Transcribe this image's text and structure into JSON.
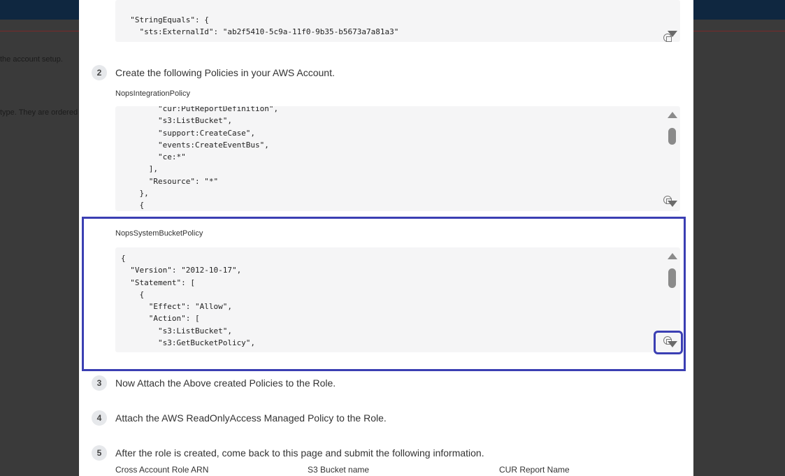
{
  "background": {
    "text_1": "the account setup.",
    "text_2": "type. They are ordered"
  },
  "top_code": {
    "lines": [
      "  \"StringEquals\": {",
      "    \"sts:ExternalId\": \"ab2f5410-5c9a-11f0-9b35-b5673a7a81a3\""
    ]
  },
  "steps": [
    {
      "number": "2",
      "text": "Create the following Policies in your AWS Account."
    },
    {
      "number": "3",
      "text": "Now Attach the Above created Policies to the Role."
    },
    {
      "number": "4",
      "text": "Attach the AWS ReadOnlyAccess Managed Policy to the Role."
    },
    {
      "number": "5",
      "text": "After the role is created, come back to this page and submit the following information."
    }
  ],
  "policies": [
    {
      "name": "NopsIntegrationPolicy",
      "code": "        \"cur:PutReportDefinition\",\n        \"s3:ListBucket\",\n        \"support:CreateCase\",\n        \"events:CreateEventBus\",\n        \"ce:*\"\n      ],\n      \"Resource\": \"*\"\n    },\n    {"
    },
    {
      "name": "NopsSystemBucketPolicy",
      "code": "{\n  \"Version\": \"2012-10-17\",\n  \"Statement\": [\n    {\n      \"Effect\": \"Allow\",\n      \"Action\": [\n        \"s3:ListBucket\",\n        \"s3:GetBucketPolicy\","
    }
  ],
  "fields": {
    "role_arn_label": "Cross Account Role ARN",
    "bucket_label": "S3 Bucket name",
    "cur_label": "CUR Report Name"
  }
}
